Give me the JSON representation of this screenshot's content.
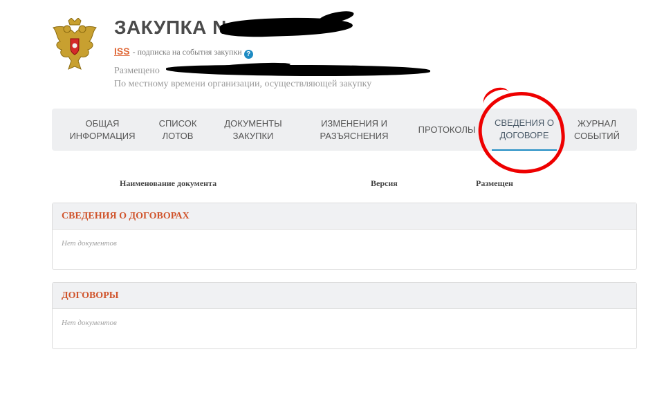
{
  "header": {
    "title": "ЗАКУПКА N",
    "rss_label": "ISS",
    "subscription_text": "- подписка на события закупки",
    "help_glyph": "?",
    "posted_label": "Размещено",
    "local_time_note": "По местному времени организации, осуществляющей закупку"
  },
  "tabs": [
    {
      "label": "ОБЩАЯ ИНФОРМАЦИЯ",
      "active": false
    },
    {
      "label": "СПИСОК ЛОТОВ",
      "active": false
    },
    {
      "label": "ДОКУМЕНТЫ ЗАКУПКИ",
      "active": false
    },
    {
      "label": "ИЗМЕНЕНИЯ И РАЗЪЯСНЕНИЯ",
      "active": false
    },
    {
      "label": "ПРОТОКОЛЫ",
      "active": false
    },
    {
      "label": "СВЕДЕНИЯ О ДОГОВОРЕ",
      "active": true
    },
    {
      "label": "ЖУРНАЛ СОБЫТИЙ",
      "active": false
    }
  ],
  "table_columns": [
    "Наименование документа",
    "Версия",
    "Размещен"
  ],
  "sections": [
    {
      "title": "СВЕДЕНИЯ О ДОГОВОРАХ",
      "empty_text": "Нет документов"
    },
    {
      "title": "ДОГОВОРЫ",
      "empty_text": "Нет документов"
    }
  ],
  "colors": {
    "accent": "#1e8bc3",
    "section_title": "#d0542c",
    "rss_link": "#e06a3a",
    "annotation": "#ee0000"
  }
}
